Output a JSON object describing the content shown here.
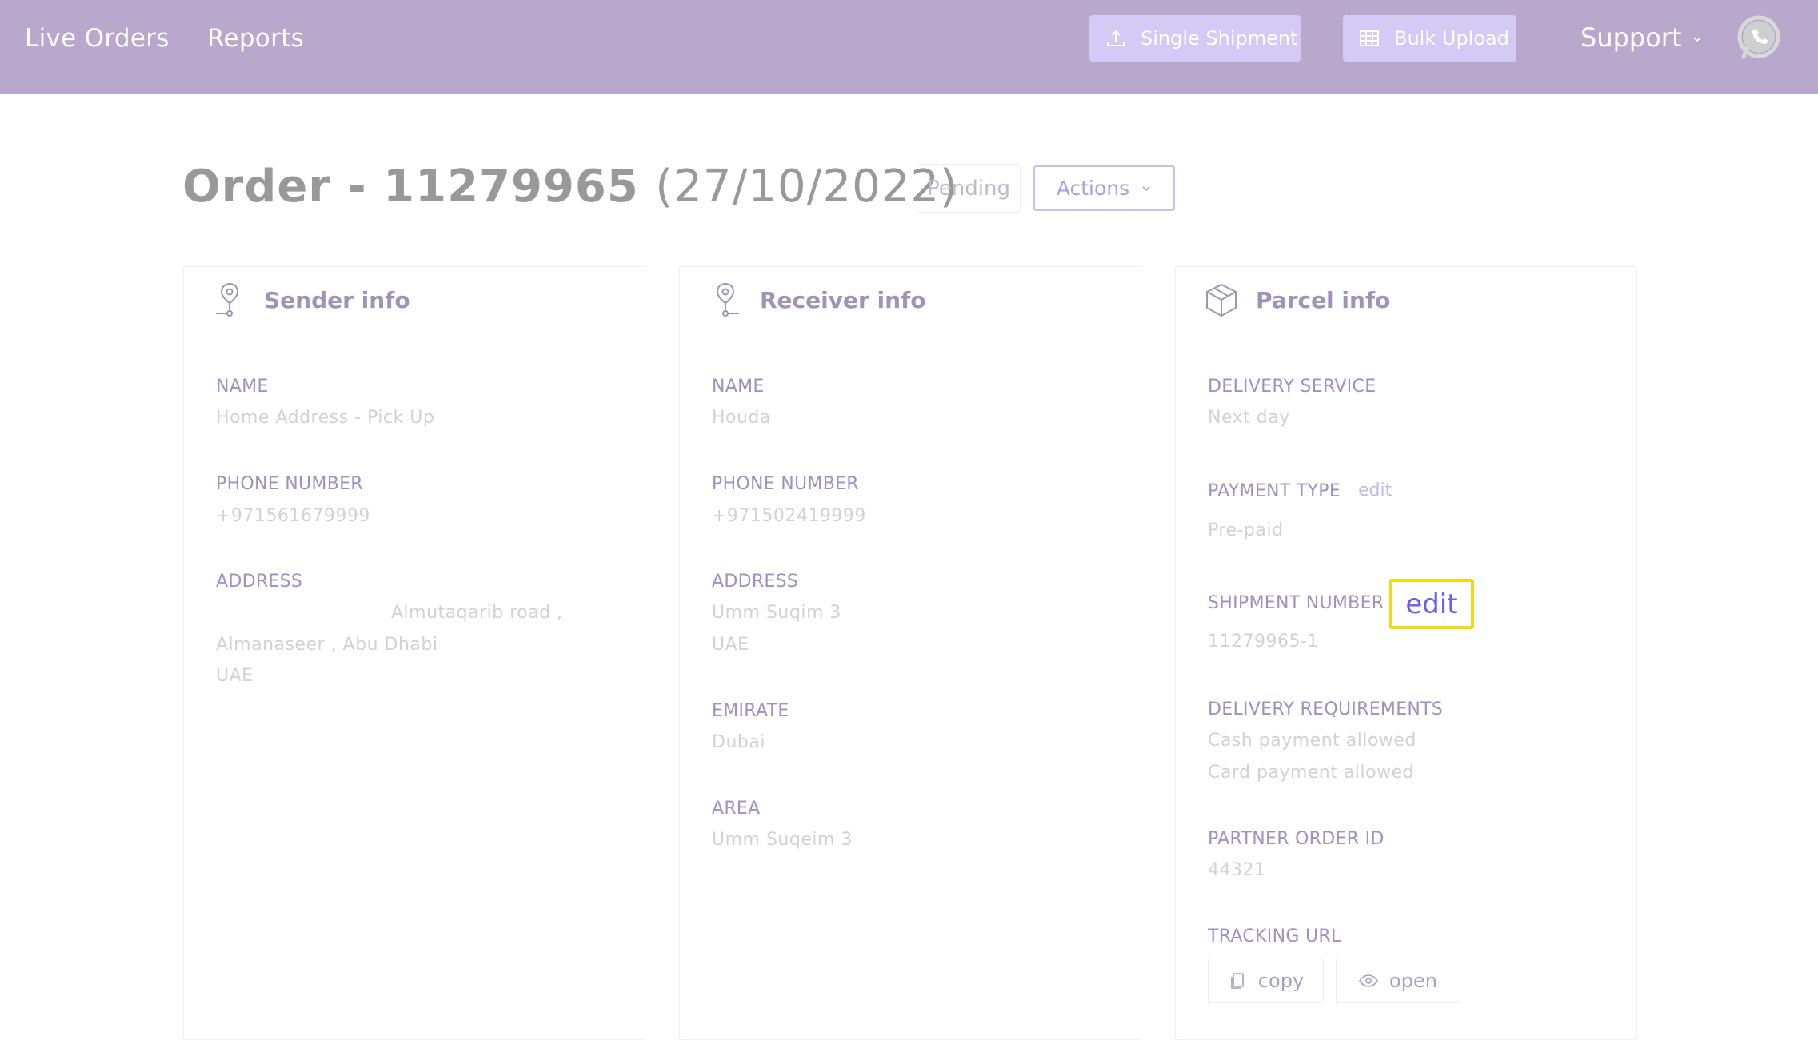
{
  "nav": {
    "live_orders": "Live Orders",
    "reports": "Reports",
    "single_shipment": "Single Shipment",
    "bulk_upload": "Bulk Upload",
    "support": "Support"
  },
  "order": {
    "title": "Order - 11279965",
    "date": "(27/10/2022)",
    "status": "Pending",
    "actions_label": "Actions"
  },
  "sender": {
    "title": "Sender info",
    "name_label": "NAME",
    "name": "Home Address - Pick Up",
    "phone_label": "PHONE NUMBER",
    "phone": "+971561679999",
    "address_label": "ADDRESS",
    "address_line1": "Almutaqarib road ,",
    "address_line2": "Almanaseer , Abu Dhabi",
    "address_line3": "UAE"
  },
  "receiver": {
    "title": "Receiver info",
    "name_label": "NAME",
    "name": "Houda",
    "phone_label": "PHONE NUMBER",
    "phone": "+971502419999",
    "address_label": "ADDRESS",
    "address_line1": "Umm Suqim 3",
    "address_line2": "UAE",
    "emirate_label": "EMIRATE",
    "emirate": "Dubai",
    "area_label": "AREA",
    "area": "Umm Suqeim 3"
  },
  "parcel": {
    "title": "Parcel info",
    "delivery_service_label": "DELIVERY SERVICE",
    "delivery_service": "Next day",
    "payment_type_label": "PAYMENT TYPE",
    "payment_edit": "edit",
    "payment_type": "Pre-paid",
    "shipment_number_label": "SHIPMENT NUMBER",
    "shipment_edit": "edit",
    "shipment_number": "11279965-1",
    "delivery_requirements_label": "DELIVERY REQUIREMENTS",
    "requirement_1": "Cash payment allowed",
    "requirement_2": "Card payment allowed",
    "partner_order_id_label": "PARTNER ORDER ID",
    "partner_order_id": "44321",
    "tracking_url_label": "TRACKING URL",
    "copy_label": "copy",
    "open_label": "open"
  },
  "colors": {
    "topbar": "#b8a9cc",
    "accent": "#6a5ef0",
    "highlight": "#f5d90f"
  }
}
